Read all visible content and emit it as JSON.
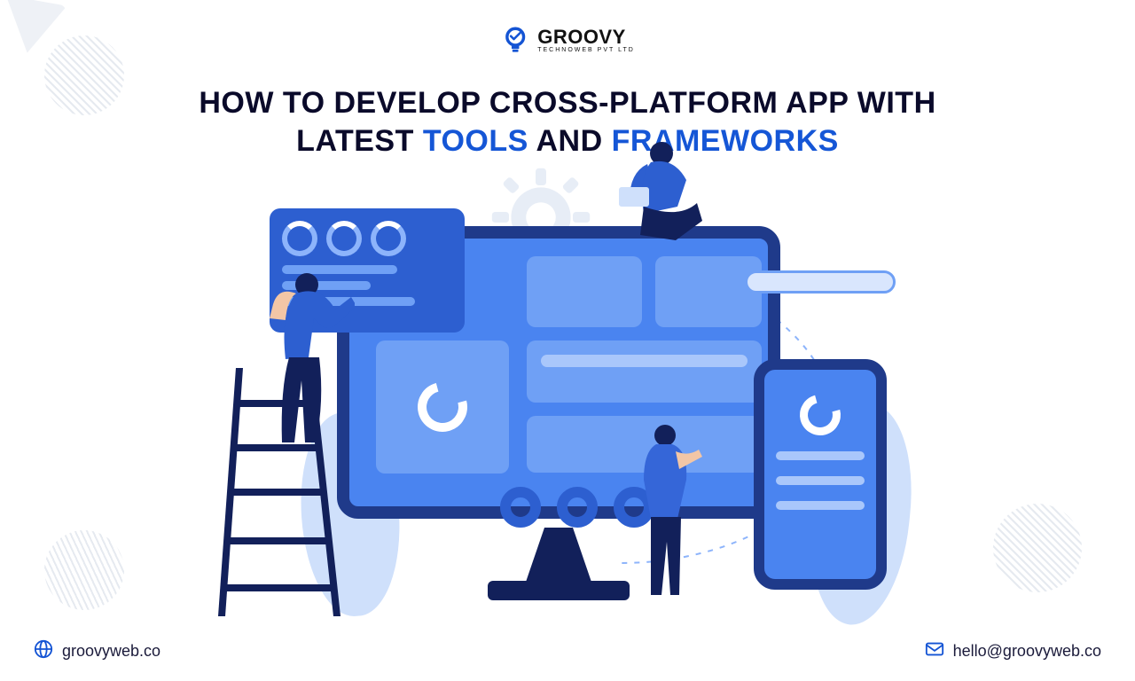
{
  "brand": {
    "name": "GROOVY",
    "tagline": "TECHNOWEB PVT LTD"
  },
  "headline": {
    "pre": "HOW TO DEVELOP CROSS-PLATFORM APP WITH",
    "line2_a": "LATEST ",
    "accent1": "TOOLS",
    "mid": " AND ",
    "accent2": "FRAMEWORKS"
  },
  "footer": {
    "website": "groovyweb.co",
    "email": "hello@groovyweb.co"
  },
  "colors": {
    "accent": "#1556d6",
    "dark": "#0a0a2a"
  }
}
